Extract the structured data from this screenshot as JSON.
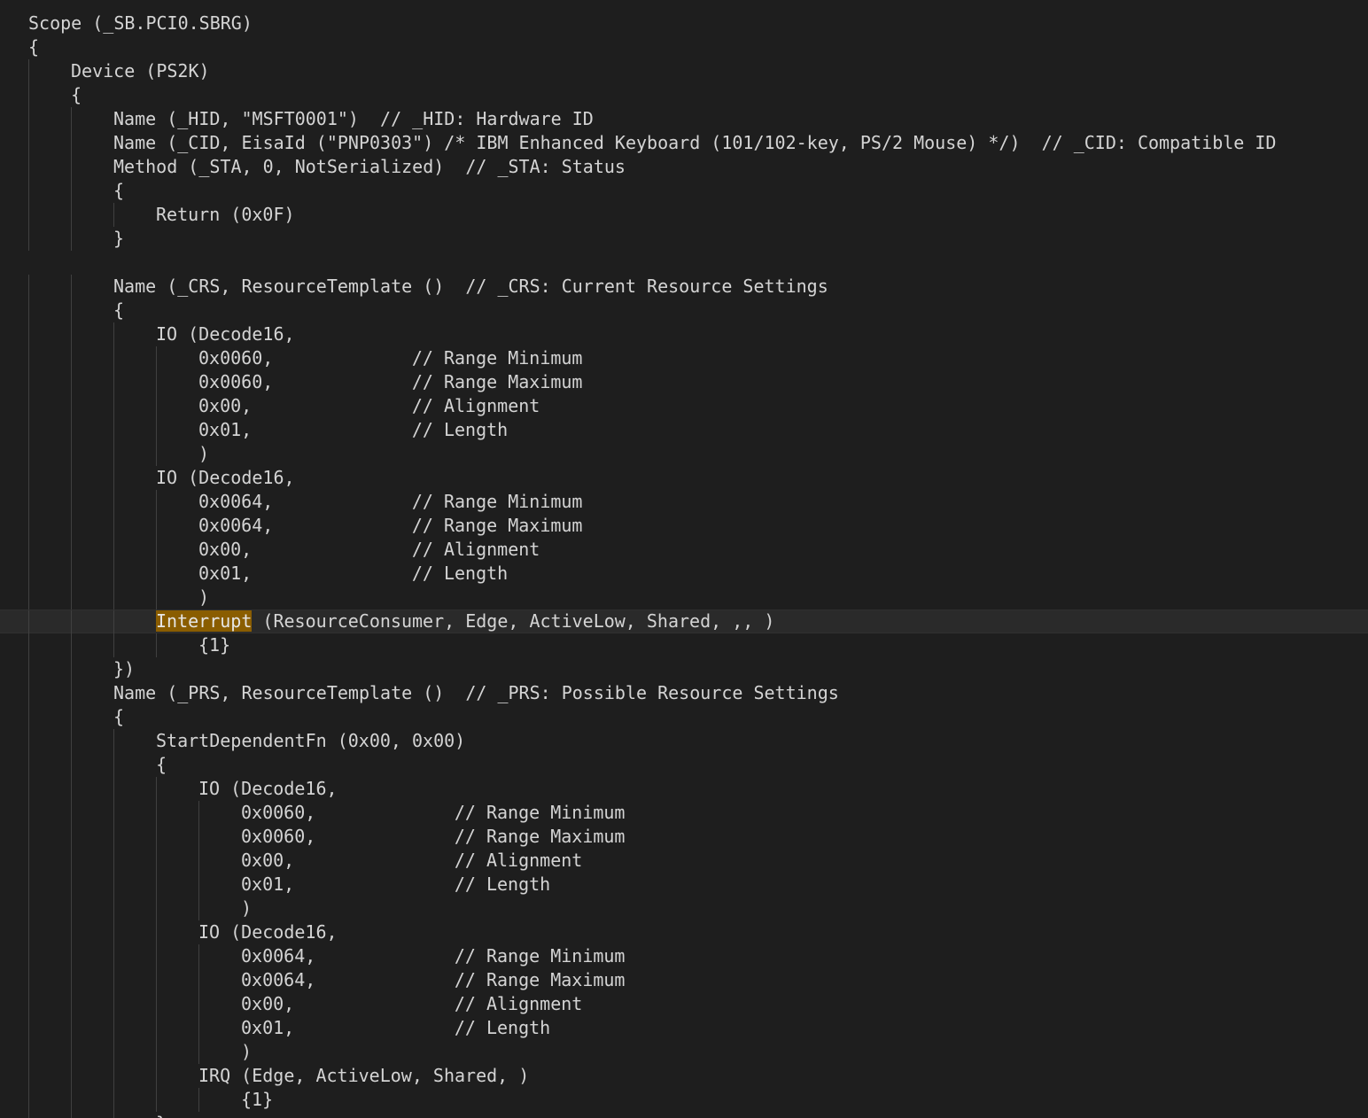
{
  "editor": {
    "highlight_word": "Interrupt",
    "colors": {
      "background": "#1e1e1e",
      "text": "#d4d4d4",
      "current_line": "#2a2a2a",
      "indent_guide": "#404040",
      "word_highlight": "#8a5d00"
    },
    "lines": [
      {
        "indent": 0,
        "text": "Scope (_SB.PCI0.SBRG)"
      },
      {
        "indent": 0,
        "text": "{"
      },
      {
        "indent": 1,
        "text": "Device (PS2K)"
      },
      {
        "indent": 1,
        "text": "{"
      },
      {
        "indent": 2,
        "text": "Name (_HID, \"MSFT0001\")  // _HID: Hardware ID"
      },
      {
        "indent": 2,
        "text": "Name (_CID, EisaId (\"PNP0303\") /* IBM Enhanced Keyboard (101/102-key, PS/2 Mouse) */)  // _CID: Compatible ID"
      },
      {
        "indent": 2,
        "text": "Method (_STA, 0, NotSerialized)  // _STA: Status"
      },
      {
        "indent": 2,
        "text": "{"
      },
      {
        "indent": 3,
        "text": "Return (0x0F)"
      },
      {
        "indent": 2,
        "text": "}"
      },
      {
        "indent": 0,
        "text": ""
      },
      {
        "indent": 2,
        "text": "Name (_CRS, ResourceTemplate ()  // _CRS: Current Resource Settings"
      },
      {
        "indent": 2,
        "text": "{"
      },
      {
        "indent": 3,
        "text": "IO (Decode16,"
      },
      {
        "indent": 4,
        "text": "0x0060,             // Range Minimum"
      },
      {
        "indent": 4,
        "text": "0x0060,             // Range Maximum"
      },
      {
        "indent": 4,
        "text": "0x00,               // Alignment"
      },
      {
        "indent": 4,
        "text": "0x01,               // Length"
      },
      {
        "indent": 4,
        "text": ")"
      },
      {
        "indent": 3,
        "text": "IO (Decode16,"
      },
      {
        "indent": 4,
        "text": "0x0064,             // Range Minimum"
      },
      {
        "indent": 4,
        "text": "0x0064,             // Range Maximum"
      },
      {
        "indent": 4,
        "text": "0x00,               // Alignment"
      },
      {
        "indent": 4,
        "text": "0x01,               // Length"
      },
      {
        "indent": 4,
        "text": ")"
      },
      {
        "indent": 3,
        "text": "Interrupt (ResourceConsumer, Edge, ActiveLow, Shared, ,, )",
        "current": true
      },
      {
        "indent": 4,
        "text": "{1}"
      },
      {
        "indent": 2,
        "text": "})"
      },
      {
        "indent": 2,
        "text": "Name (_PRS, ResourceTemplate ()  // _PRS: Possible Resource Settings"
      },
      {
        "indent": 2,
        "text": "{"
      },
      {
        "indent": 3,
        "text": "StartDependentFn (0x00, 0x00)"
      },
      {
        "indent": 3,
        "text": "{"
      },
      {
        "indent": 4,
        "text": "IO (Decode16,"
      },
      {
        "indent": 5,
        "text": "0x0060,             // Range Minimum"
      },
      {
        "indent": 5,
        "text": "0x0060,             // Range Maximum"
      },
      {
        "indent": 5,
        "text": "0x00,               // Alignment"
      },
      {
        "indent": 5,
        "text": "0x01,               // Length"
      },
      {
        "indent": 5,
        "text": ")"
      },
      {
        "indent": 4,
        "text": "IO (Decode16,"
      },
      {
        "indent": 5,
        "text": "0x0064,             // Range Minimum"
      },
      {
        "indent": 5,
        "text": "0x0064,             // Range Maximum"
      },
      {
        "indent": 5,
        "text": "0x00,               // Alignment"
      },
      {
        "indent": 5,
        "text": "0x01,               // Length"
      },
      {
        "indent": 5,
        "text": ")"
      },
      {
        "indent": 4,
        "text": "IRQ (Edge, ActiveLow, Shared, )"
      },
      {
        "indent": 5,
        "text": "{1}"
      },
      {
        "indent": 3,
        "text": "}"
      }
    ]
  }
}
